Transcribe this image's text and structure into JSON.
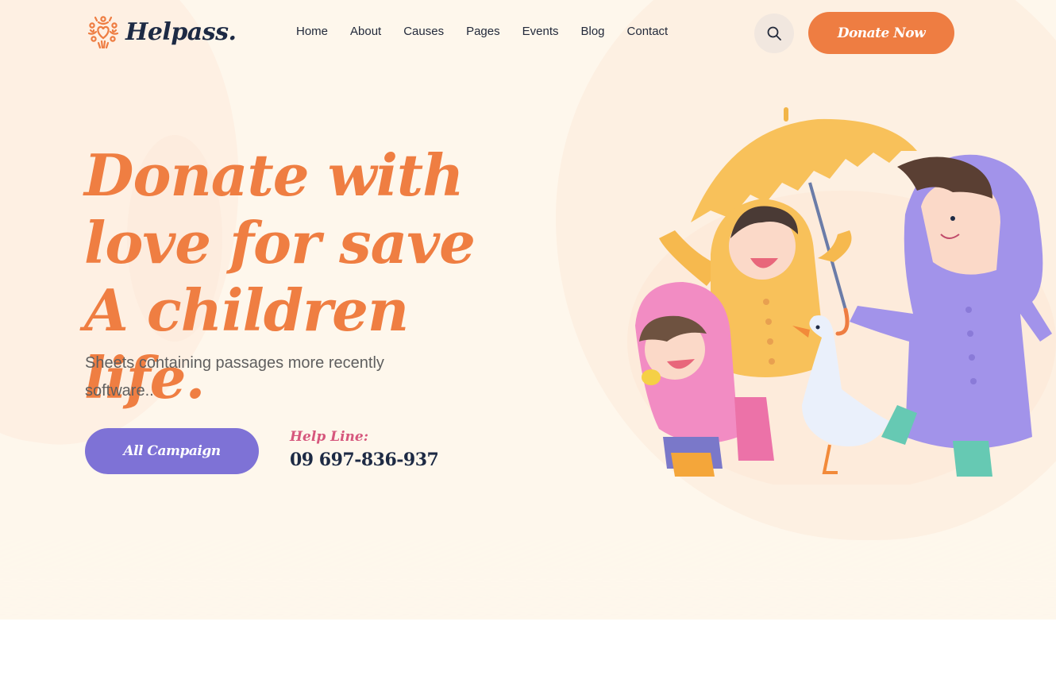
{
  "header": {
    "logo_text": "Helpass.",
    "nav": [
      {
        "label": "Home"
      },
      {
        "label": "About"
      },
      {
        "label": "Causes"
      },
      {
        "label": "Pages"
      },
      {
        "label": "Events"
      },
      {
        "label": "Blog"
      },
      {
        "label": "Contact"
      }
    ],
    "search_icon": "search-icon",
    "donate_label": "Donate Now"
  },
  "hero": {
    "headline": "Donate with love for save A children life.",
    "subtext": "Sheets containing passages more recently software..",
    "campaign_label": "All Campaign",
    "helpline_label": "Help Line:",
    "helpline_number": "09 697-836-937",
    "illustration": "children-in-raincoats-with-umbrella-and-duck"
  },
  "colors": {
    "primary_orange": "#ee7d42",
    "campaign_purple": "#7e72d6",
    "helpline_pink": "#d6577d",
    "navy": "#1d2a44",
    "hero_bg": "#fef7ec"
  }
}
